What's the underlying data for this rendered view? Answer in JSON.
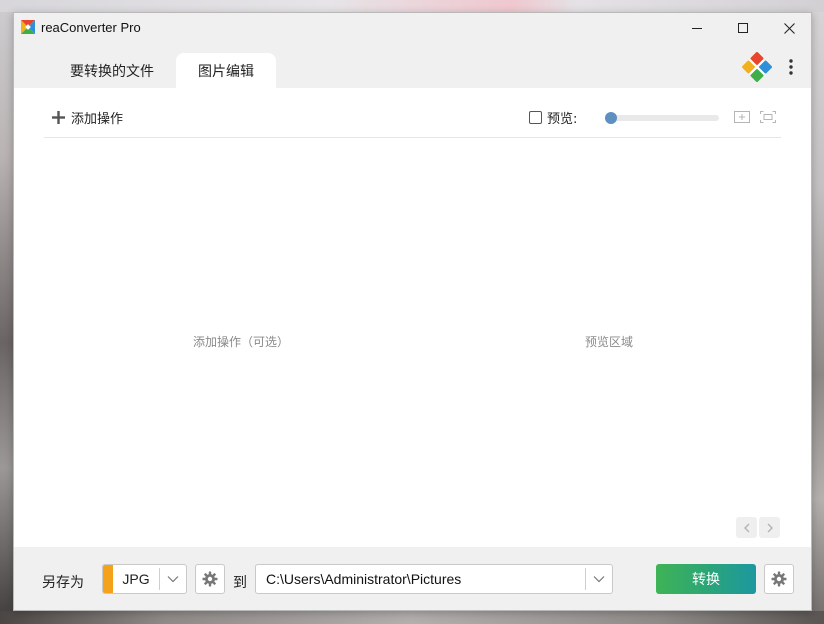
{
  "window": {
    "title": "reaConverter Pro",
    "controls": {
      "minimize": "minimize-icon",
      "maximize": "maximize-icon",
      "close": "close-icon"
    }
  },
  "tabs": [
    {
      "label": "要转换的文件",
      "active": false
    },
    {
      "label": "图片编辑",
      "active": true
    }
  ],
  "toolbar": {
    "add_operation_label": "添加操作",
    "preview_label": "预览:",
    "preview_checked": false,
    "zoom_level": 0.0
  },
  "panels": {
    "operations_placeholder": "添加操作（可选）",
    "preview_placeholder": "预览区域"
  },
  "bottom": {
    "save_as_label": "另存为",
    "format_value": "JPG",
    "to_label": "到",
    "output_path": "C:\\Users\\Administrator\\Pictures",
    "convert_label": "转换"
  },
  "colors": {
    "format_swatch": "#f5a21b",
    "convert_start": "#3fb355",
    "convert_end": "#1d98a0",
    "slider_thumb": "#5d8fc0"
  }
}
